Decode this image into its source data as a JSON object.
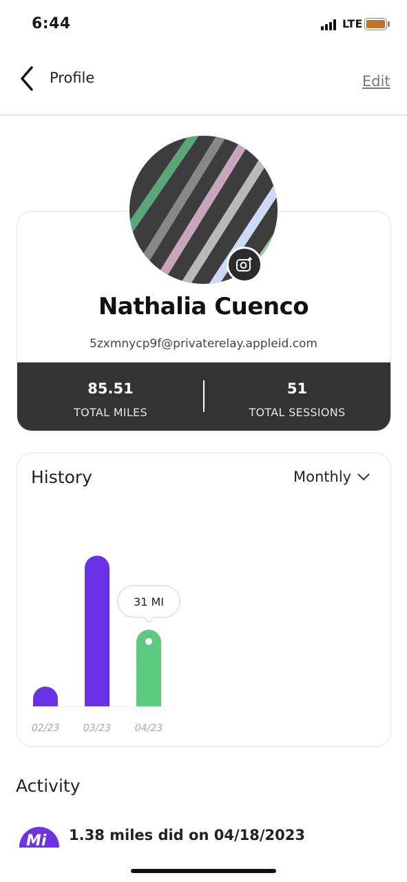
{
  "status_bar": {
    "time": "6:44",
    "network": "LTE"
  },
  "nav": {
    "title": "Profile",
    "edit_label": "Edit",
    "back_icon": "chevron-left-icon"
  },
  "profile": {
    "name": "Nathalia Cuenco",
    "email": "5zxmnycp9f@privaterelay.appleid.com",
    "camera_icon": "camera-plus-icon",
    "stats": [
      {
        "value": "85.51",
        "label": "TOTAL MILES"
      },
      {
        "value": "51",
        "label": "TOTAL SESSIONS"
      }
    ]
  },
  "history": {
    "title": "History",
    "period": "Monthly",
    "dropdown_icon": "chevron-down-icon"
  },
  "chart_data": {
    "type": "bar",
    "categories": [
      "02/23",
      "03/23",
      "04/23"
    ],
    "values": [
      8,
      61,
      31
    ],
    "colors": [
      "#6a31e6",
      "#6a31e6",
      "#5cca7f"
    ],
    "selected_index": 2,
    "tooltip": "31 MI",
    "ylim": [
      0,
      65
    ]
  },
  "activity": {
    "title": "Activity",
    "items": [
      {
        "text": "1.38 miles did on 04/18/2023",
        "icon": "mi-badge-icon",
        "icon_text": "Mi"
      }
    ]
  },
  "colors": {
    "accent_purple": "#6a31e6",
    "accent_green": "#5cca7f",
    "stats_bg": "#333333"
  }
}
